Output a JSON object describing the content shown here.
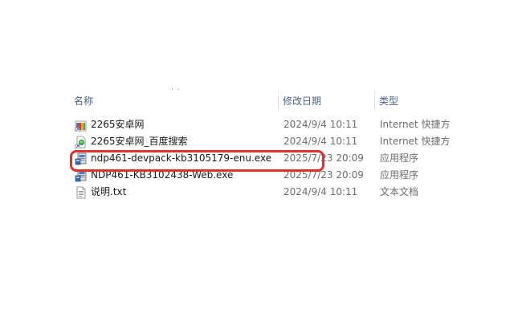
{
  "header": {
    "dots": "· ·",
    "name_label": "名称",
    "date_label": "修改日期",
    "type_label": "类型"
  },
  "files": [
    {
      "name": "2265安卓网",
      "date": "2024/9/4 10:11",
      "type": "Internet 快捷方式",
      "icon": "internet-shortcut-icon"
    },
    {
      "name": "2265安卓网_百度搜索",
      "date": "2024/9/4 10:11",
      "type": "Internet 快捷方式",
      "icon": "internet-shortcut-icon"
    },
    {
      "name": "ndp461-devpack-kb3105179-enu.exe",
      "date": "2025/7/23 20:09",
      "type": "应用程序",
      "icon": "installer-exe-icon"
    },
    {
      "name": "NDP461-KB3102438-Web.exe",
      "date": "2025/7/23 20:09",
      "type": "应用程序",
      "icon": "installer-exe-icon"
    },
    {
      "name": "说明.txt",
      "date": "2024/9/4 10:11",
      "type": "文本文档",
      "icon": "text-document-icon"
    }
  ],
  "highlight_color": "#e0322a"
}
